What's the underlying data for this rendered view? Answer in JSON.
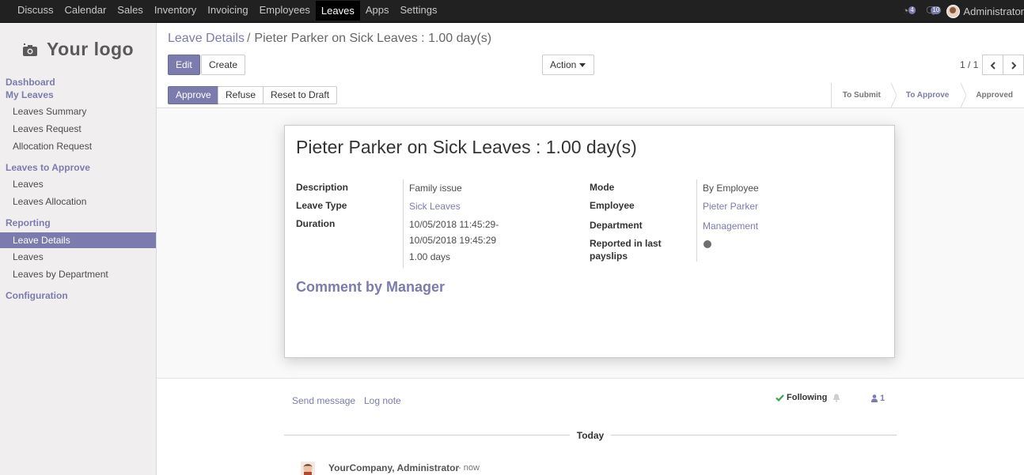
{
  "topnav": {
    "menu": [
      "Discuss",
      "Calendar",
      "Sales",
      "Inventory",
      "Invoicing",
      "Employees",
      "Leaves",
      "Apps",
      "Settings"
    ],
    "active": "Leaves",
    "activity_count": "4",
    "message_count": "10",
    "user": "Administrator"
  },
  "sidebar": {
    "logo_text": "Your logo",
    "dashboard": "Dashboard",
    "my_leaves": "My Leaves",
    "my_leaves_items": [
      "Leaves Summary",
      "Leaves Request",
      "Allocation Request"
    ],
    "to_approve": "Leaves to Approve",
    "to_approve_items": [
      "Leaves",
      "Leaves Allocation"
    ],
    "reporting": "Reporting",
    "reporting_items": [
      "Leave Details",
      "Leaves",
      "Leaves by Department"
    ],
    "configuration": "Configuration"
  },
  "control": {
    "breadcrumb_parent": "Leave Details",
    "breadcrumb_sep": "/",
    "breadcrumb_current": "Pieter Parker on Sick Leaves : 1.00 day(s)",
    "edit": "Edit",
    "create": "Create",
    "action": "Action",
    "pager": "1 / 1"
  },
  "statusbar": {
    "approve": "Approve",
    "refuse": "Refuse",
    "reset": "Reset to Draft",
    "stages": [
      "To Submit",
      "To Approve",
      "Approved"
    ],
    "current_stage": "To Approve"
  },
  "form": {
    "title": "Pieter Parker on Sick Leaves : 1.00 day(s)",
    "description_label": "Description",
    "description": "Family issue",
    "leave_type_label": "Leave Type",
    "leave_type": "Sick Leaves",
    "duration_label": "Duration",
    "date_from": "10/05/2018 11:45:29-",
    "date_to": "10/05/2018 19:45:29",
    "days": "1.00 days",
    "mode_label": "Mode",
    "mode": "By Employee",
    "employee_label": "Employee",
    "employee": "Pieter Parker",
    "department_label": "Department",
    "department": "Management",
    "reported_label_1": "Reported in last",
    "reported_label_2": "payslips",
    "comment_title": "Comment by Manager"
  },
  "chatter": {
    "send_message": "Send message",
    "log_note": "Log note",
    "following": "Following",
    "followers_count": "1",
    "today": "Today",
    "author": "YourCompany, Administrator",
    "time": "- now"
  },
  "colors": {
    "primary": "#7c7bad",
    "topbar": "#212121",
    "sidebar_bg": "#f0eeee"
  }
}
